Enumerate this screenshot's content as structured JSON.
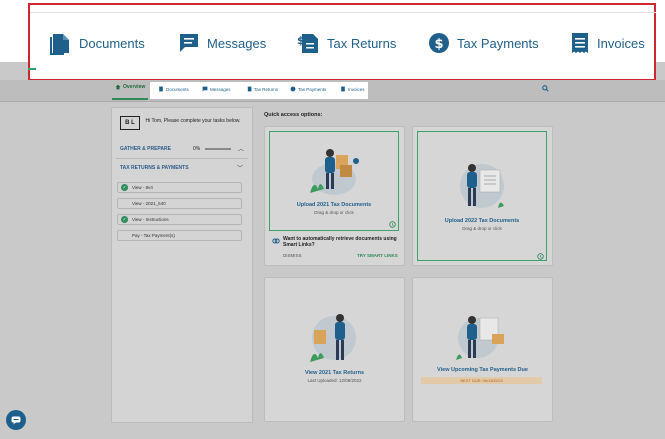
{
  "callout": {
    "items": [
      {
        "label": "Documents",
        "icon": "documents-icon"
      },
      {
        "label": "Messages",
        "icon": "messages-icon"
      },
      {
        "label": "Tax Returns",
        "icon": "tax-returns-icon"
      },
      {
        "label": "Tax Payments",
        "icon": "tax-payments-icon"
      },
      {
        "label": "Invoices",
        "icon": "invoices-icon"
      }
    ]
  },
  "nav": {
    "overview": "Overview",
    "items": [
      "Documents",
      "Messages",
      "Tax Returns",
      "Tax Payments",
      "Invoices"
    ]
  },
  "sidebar": {
    "logo": "B L",
    "greeting": "Hi Tom, Please complete your tasks below.",
    "gather_title": "GATHER & PREPARE",
    "gather_percent": "0%",
    "gather_progress": 0.0,
    "tax_title": "TAX RETURNS & PAYMENTS",
    "tasks": [
      {
        "label": "View - 8v4",
        "done": true
      },
      {
        "label": "View - 2021_540",
        "done": false
      },
      {
        "label": "View - Instructions",
        "done": true
      },
      {
        "label": "Pay - Tax Payment(s)",
        "done": false
      }
    ]
  },
  "main": {
    "quick_access_label": "Quick access options:",
    "cards": {
      "upload2021": {
        "title": "Upload 2021 Tax Documents",
        "sub": "Drag & drop or click"
      },
      "upload2022": {
        "title": "Upload 2022 Tax Documents",
        "sub": "Drag & drop or click"
      },
      "smart": {
        "text": "Want to automatically retrieve documents using Smart Links?",
        "dismiss": "DISMISS",
        "try": "TRY SMART LINKS"
      },
      "view2021": {
        "title": "View 2021 Tax Returns",
        "sub": "Last Uploaded: 12/08/2022"
      },
      "payments": {
        "title": "View Upcoming Tax Payments Due",
        "next_due": "NEXT DUE: 06/15/2023"
      }
    }
  },
  "colors": {
    "accent": "#1f5f8b",
    "green": "#2e8b57",
    "highlight": "#d0262f"
  }
}
